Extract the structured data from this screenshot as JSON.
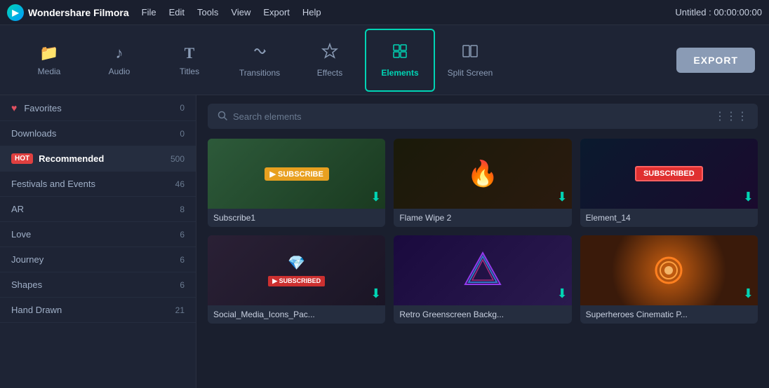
{
  "app": {
    "name": "Wondershare Filmora",
    "title": "Untitled : 00:00:00:00"
  },
  "menu": {
    "items": [
      "File",
      "Edit",
      "Tools",
      "View",
      "Export",
      "Help"
    ]
  },
  "toolbar": {
    "tools": [
      {
        "id": "media",
        "label": "Media",
        "icon": "📁"
      },
      {
        "id": "audio",
        "label": "Audio",
        "icon": "♪"
      },
      {
        "id": "titles",
        "label": "Titles",
        "icon": "T"
      },
      {
        "id": "transitions",
        "label": "Transitions",
        "icon": "✦"
      },
      {
        "id": "effects",
        "label": "Effects",
        "icon": "✧"
      },
      {
        "id": "elements",
        "label": "Elements",
        "icon": "⬡",
        "active": true
      },
      {
        "id": "split-screen",
        "label": "Split Screen",
        "icon": "⊞"
      }
    ],
    "export_label": "EXPORT"
  },
  "sidebar": {
    "items": [
      {
        "id": "favorites",
        "label": "Favorites",
        "count": "0",
        "has_heart": true,
        "active": false
      },
      {
        "id": "downloads",
        "label": "Downloads",
        "count": "0",
        "has_heart": false,
        "active": false
      },
      {
        "id": "recommended",
        "label": "Recommended",
        "count": "500",
        "has_hot": true,
        "active": true
      },
      {
        "id": "festivals",
        "label": "Festivals and Events",
        "count": "46",
        "active": false
      },
      {
        "id": "ar",
        "label": "AR",
        "count": "8",
        "active": false
      },
      {
        "id": "love",
        "label": "Love",
        "count": "6",
        "active": false
      },
      {
        "id": "journey",
        "label": "Journey",
        "count": "6",
        "active": false
      },
      {
        "id": "shapes",
        "label": "Shapes",
        "count": "6",
        "active": false
      },
      {
        "id": "hand-drawn",
        "label": "Hand Drawn",
        "count": "21",
        "active": false
      }
    ]
  },
  "search": {
    "placeholder": "Search elements"
  },
  "elements": {
    "items": [
      {
        "id": "subscribe1",
        "name": "Subscribe1",
        "thumb_class": "thumb-subscribe",
        "emoji": "📺"
      },
      {
        "id": "flame-wipe-2",
        "name": "Flame Wipe 2",
        "thumb_class": "thumb-flame",
        "emoji": "🔥"
      },
      {
        "id": "element-14",
        "name": "Element_14",
        "thumb_class": "thumb-subscribed",
        "emoji": "🔔"
      },
      {
        "id": "social-media",
        "name": "Social_Media_Icons_Pac...",
        "thumb_class": "thumb-social",
        "emoji": "💎"
      },
      {
        "id": "retro-bg",
        "name": "Retro Greenscreen Backg...",
        "thumb_class": "thumb-retro",
        "emoji": "🔺"
      },
      {
        "id": "superheroes",
        "name": "Superheroes Cinematic P...",
        "thumb_class": "thumb-superheroes",
        "emoji": "✨"
      }
    ]
  },
  "icons": {
    "search": "🔍",
    "grid": "⋯",
    "download": "⬇",
    "heart": "♥",
    "hot": "HOT",
    "collapse": "◀"
  }
}
